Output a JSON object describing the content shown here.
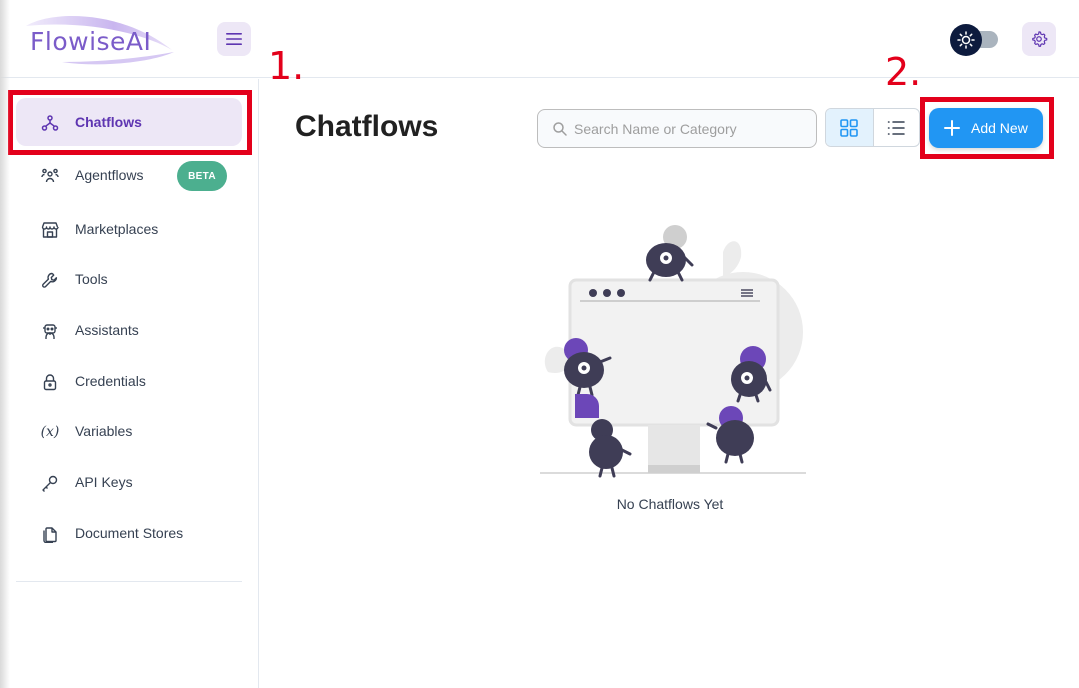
{
  "app": {
    "logo_text": "FlowiseAI"
  },
  "header": {
    "menu_icon": "hamburger-menu-icon",
    "theme_toggle_icon": "sun-icon",
    "settings_icon": "gear-icon"
  },
  "sidebar": {
    "items": [
      {
        "label": "Chatflows",
        "icon": "chatflow-icon",
        "active": true
      },
      {
        "label": "Agentflows",
        "icon": "users-icon",
        "badge": "BETA"
      },
      {
        "label": "Marketplaces",
        "icon": "store-icon"
      },
      {
        "label": "Tools",
        "icon": "wrench-icon"
      },
      {
        "label": "Assistants",
        "icon": "robot-icon"
      },
      {
        "label": "Credentials",
        "icon": "lock-icon"
      },
      {
        "label": "Variables",
        "icon": "variable-icon",
        "glyph": "(x)"
      },
      {
        "label": "API Keys",
        "icon": "key-icon"
      },
      {
        "label": "Document Stores",
        "icon": "files-icon"
      }
    ]
  },
  "main": {
    "title": "Chatflows",
    "search": {
      "placeholder": "Search Name or Category",
      "value": ""
    },
    "add_button": {
      "label": "Add New"
    },
    "empty_state": "No Chatflows Yet"
  },
  "annotations": {
    "step1": "1.",
    "step2": "2."
  },
  "colors": {
    "accent": "#5e35b1",
    "primary": "#2196f3",
    "annotation": "#e3001b",
    "beta": "#4caf8f"
  }
}
